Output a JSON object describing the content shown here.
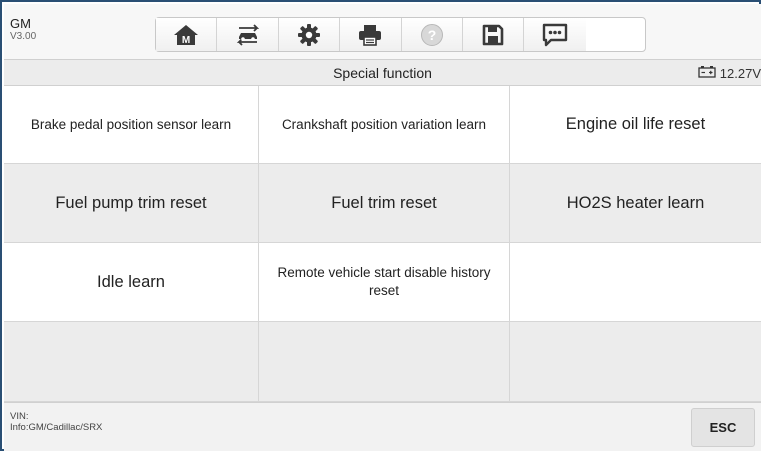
{
  "header": {
    "title": "GM",
    "version": "V3.00"
  },
  "toolbar": {
    "buttons": [
      {
        "icon": "home-icon"
      },
      {
        "icon": "vehicle-swap-icon"
      },
      {
        "icon": "gear-icon"
      },
      {
        "icon": "printer-icon"
      },
      {
        "icon": "help-icon"
      },
      {
        "icon": "save-icon"
      },
      {
        "icon": "message-icon"
      }
    ]
  },
  "titlebar": {
    "title": "Special function",
    "battery_voltage": "12.27V"
  },
  "functions": [
    {
      "label": "Brake pedal position sensor learn"
    },
    {
      "label": "Crankshaft position variation learn"
    },
    {
      "label": "Engine oil life reset"
    },
    {
      "label": "Fuel pump trim reset"
    },
    {
      "label": "Fuel trim reset"
    },
    {
      "label": "HO2S heater learn"
    },
    {
      "label": "Idle learn"
    },
    {
      "label": "Remote vehicle start disable history reset"
    },
    {
      "label": ""
    },
    {
      "label": ""
    },
    {
      "label": ""
    },
    {
      "label": ""
    }
  ],
  "footer": {
    "vin_label": "VIN:",
    "info": "Info:GM/Cadillac/SRX",
    "esc_label": "ESC"
  },
  "colors": {
    "frame_border": "#2a4f74",
    "row_gray": "#ececec",
    "icon_dark": "#3a3a3a"
  }
}
